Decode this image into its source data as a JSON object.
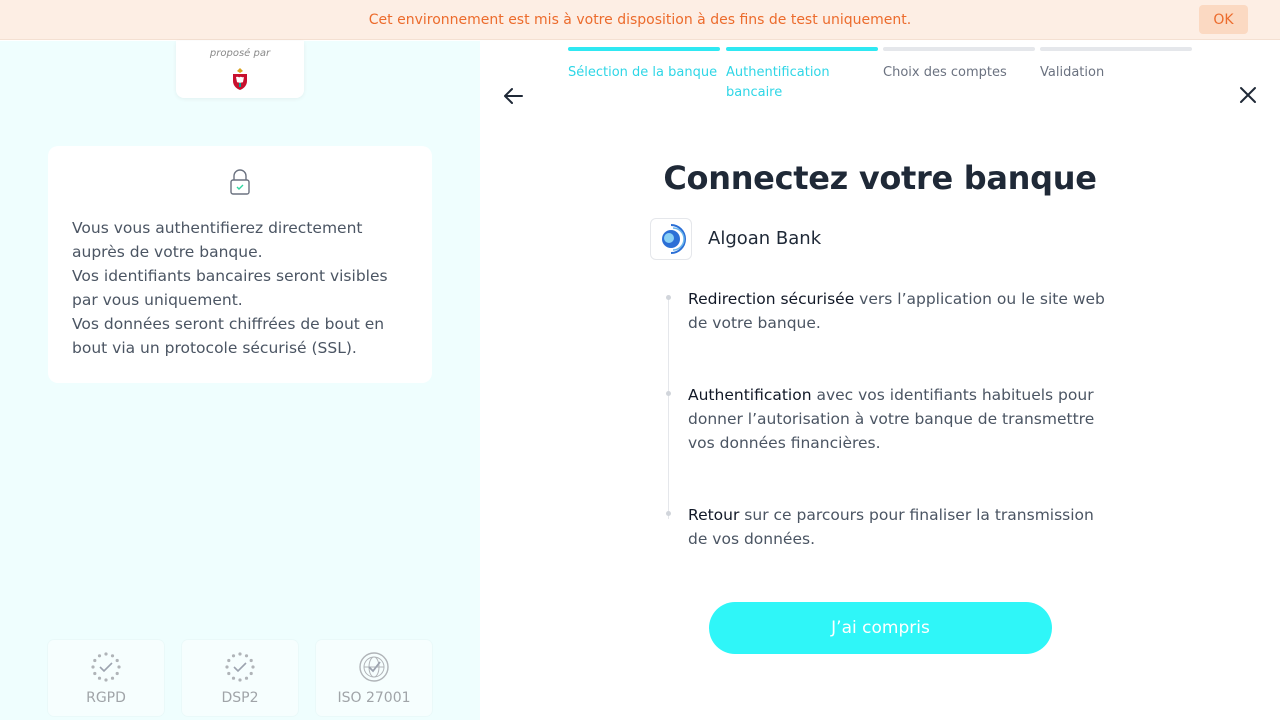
{
  "banner": {
    "text": "Cet environnement est mis à votre disposition à des fins de test uniquement.",
    "ok_label": "OK",
    "colors": {
      "background": "#fdeee4",
      "text": "#ec6b2c"
    }
  },
  "left": {
    "proposed_by": "proposé par",
    "proposed_logo": "club-crest-logo",
    "info_icon": "lock-icon",
    "info_lines": [
      "Vous vous authentifierez directement auprès de votre banque.",
      "Vos identifiants bancaires seront visibles par vous uniquement.",
      "Vos données seront chiffrées de bout en bout via un protocole sécurisé (SSL)."
    ],
    "badges": [
      {
        "label": "RGPD",
        "icon": "eu-stars-check-icon"
      },
      {
        "label": "DSP2",
        "icon": "eu-stars-check-icon"
      },
      {
        "label": "ISO 27001",
        "icon": "globe-check-icon"
      }
    ]
  },
  "stepper": {
    "steps": [
      {
        "label": "Sélection de la banque",
        "state": "done"
      },
      {
        "label": "Authentification bancaire",
        "state": "active"
      },
      {
        "label": "Choix des comptes",
        "state": "todo"
      },
      {
        "label": "Validation",
        "state": "todo"
      }
    ],
    "accent_color": "#2fe8f2"
  },
  "nav": {
    "back_icon": "arrow-left-icon",
    "close_icon": "close-icon"
  },
  "main": {
    "title": "Connectez votre banque",
    "bank": {
      "name": "Algoan Bank",
      "logo": "algoan-logo"
    },
    "steps": [
      {
        "strong": "Redirection sécurisée",
        "rest": " vers l’application ou le site web de votre banque."
      },
      {
        "strong": "Authentification",
        "rest": " avec vos identifiants habituels pour donner l’autorisation à votre banque de transmettre vos données financières."
      },
      {
        "strong": "Retour",
        "rest": " sur ce parcours pour finaliser la transmission de vos données."
      }
    ],
    "cta_label": "J’ai compris",
    "cta_color": "#2ff6f8"
  }
}
